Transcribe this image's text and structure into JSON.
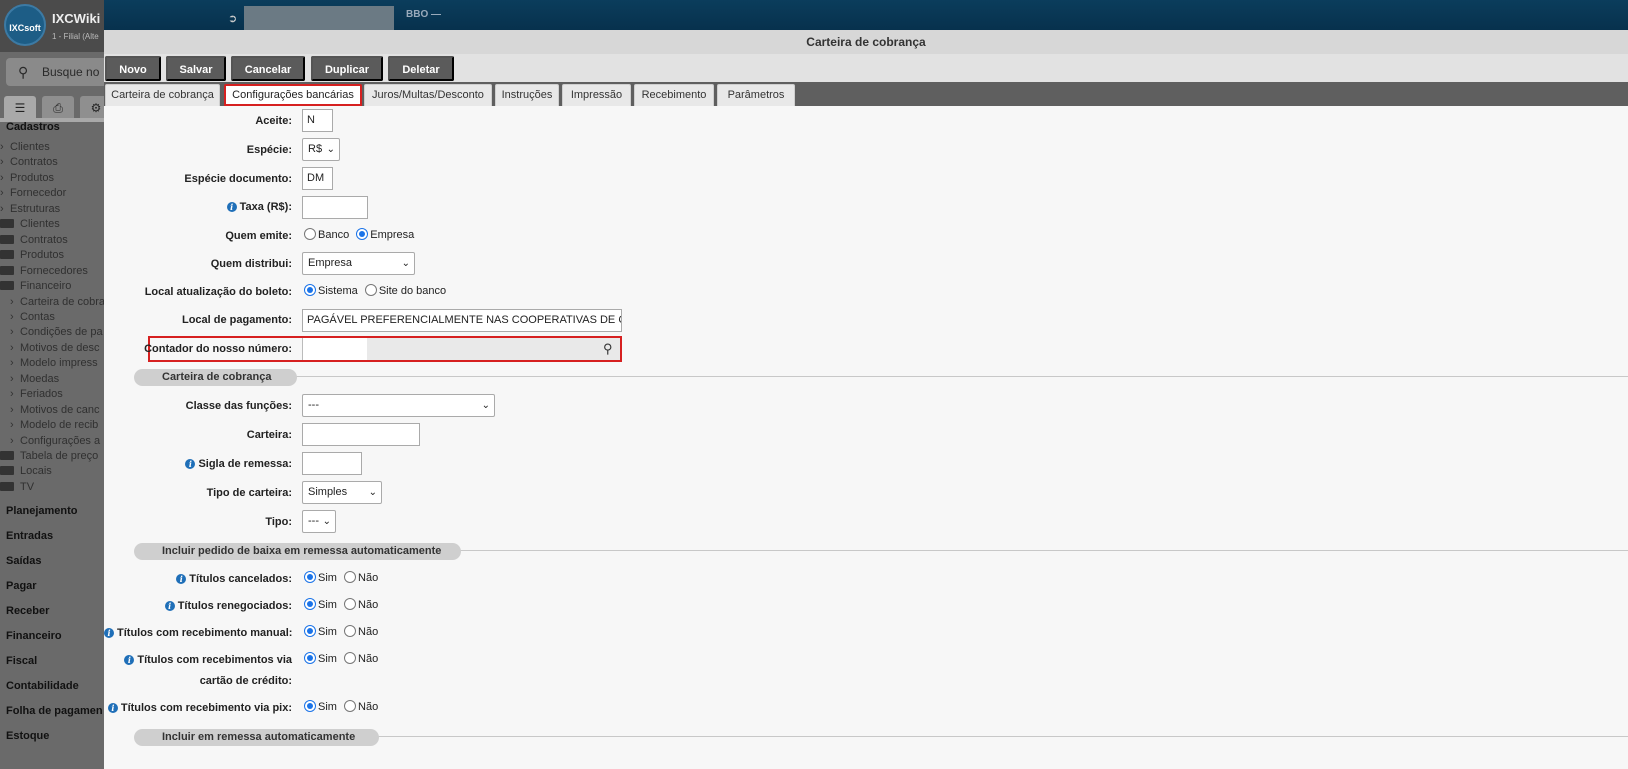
{
  "app": {
    "logo_text": "IXCsoft",
    "title": "IXCWiki",
    "subtitle": "1 - Filial (Alte",
    "search_placeholder": "Busque no",
    "topbar_text": "BBO —"
  },
  "sidebar": {
    "tab_icons": [
      "list-icon",
      "print-icon",
      "gear-icon"
    ],
    "sections_top": "Cadastros",
    "items": [
      {
        "label": "Clientes",
        "kind": "chev"
      },
      {
        "label": "Contratos",
        "kind": "chev"
      },
      {
        "label": "Produtos",
        "kind": "chev"
      },
      {
        "label": "Fornecedor",
        "kind": "chev"
      },
      {
        "label": "Estruturas",
        "kind": "chev"
      },
      {
        "label": "Clientes",
        "kind": "folder"
      },
      {
        "label": "Contratos",
        "kind": "folder"
      },
      {
        "label": "Produtos",
        "kind": "folder"
      },
      {
        "label": "Fornecedores",
        "kind": "folder"
      },
      {
        "label": "Financeiro",
        "kind": "folder-open"
      },
      {
        "label": "Carteira de cobra",
        "kind": "sub"
      },
      {
        "label": "Contas",
        "kind": "sub"
      },
      {
        "label": "Condições de pa",
        "kind": "sub"
      },
      {
        "label": "Motivos de desc",
        "kind": "sub"
      },
      {
        "label": "Modelo impress",
        "kind": "sub"
      },
      {
        "label": "Moedas",
        "kind": "sub"
      },
      {
        "label": "Feriados",
        "kind": "sub"
      },
      {
        "label": "Motivos de canc",
        "kind": "sub"
      },
      {
        "label": "Modelo de recib",
        "kind": "sub"
      },
      {
        "label": "Configurações a",
        "kind": "sub"
      },
      {
        "label": "Tabela de preço",
        "kind": "folder"
      },
      {
        "label": "Locais",
        "kind": "folder"
      },
      {
        "label": "TV",
        "kind": "folder"
      }
    ],
    "sections": [
      "Planejamento",
      "Entradas",
      "Saídas",
      "Pagar",
      "Receber",
      "Financeiro",
      "Fiscal",
      "Contabilidade",
      "Folha de pagamen",
      "Estoque"
    ]
  },
  "modal": {
    "title": "Carteira de cobrança",
    "toolbar": [
      "Novo",
      "Salvar",
      "Cancelar",
      "Duplicar",
      "Deletar"
    ],
    "tabs": [
      "Carteira de cobrança",
      "Configurações bancárias",
      "Juros/Multas/Desconto",
      "Instruções",
      "Impressão",
      "Recebimento",
      "Parâmetros"
    ],
    "active_tab": "Configurações bancárias"
  },
  "form": {
    "aceite": {
      "label": "Aceite:",
      "value": "N"
    },
    "especie": {
      "label": "Espécie:",
      "value": "R$"
    },
    "especie_documento": {
      "label": "Espécie documento:",
      "value": "DM"
    },
    "taxa": {
      "label": "Taxa (R$):",
      "value": ""
    },
    "quem_emite": {
      "label": "Quem emite:",
      "options": [
        "Banco",
        "Empresa"
      ],
      "selected": "Empresa"
    },
    "quem_distribui": {
      "label": "Quem distribui:",
      "value": "Empresa"
    },
    "local_atualizacao": {
      "label": "Local atualização do boleto:",
      "options": [
        "Sistema",
        "Site do banco"
      ],
      "selected": "Sistema"
    },
    "local_pagamento": {
      "label": "Local de pagamento:",
      "value": "PAGÁVEL PREFERENCIALMENTE NAS COOPERATIVAS DE CRE"
    },
    "contador": {
      "label": "Contador do nosso número:",
      "value": ""
    },
    "section_carteira": "Carteira de cobrança",
    "classe_funcoes": {
      "label": "Classe das funções:",
      "value": "---"
    },
    "carteira": {
      "label": "Carteira:",
      "value": ""
    },
    "sigla_remessa": {
      "label": "Sigla de remessa:",
      "value": ""
    },
    "tipo_carteira": {
      "label": "Tipo de carteira:",
      "value": "Simples"
    },
    "tipo": {
      "label": "Tipo:",
      "value": "---"
    },
    "section_baixa": "Incluir pedido de baixa em remessa automaticamente",
    "titulos": [
      {
        "label": "Títulos cancelados:",
        "selected": "Sim"
      },
      {
        "label": "Títulos renegociados:",
        "selected": "Sim"
      },
      {
        "label": "Títulos com recebimento manual:",
        "selected": "Sim"
      },
      {
        "label": "Títulos com recebimentos via",
        "label2": "cartão de crédito:",
        "selected": "Sim"
      },
      {
        "label": "Títulos com recebimento via pix:",
        "selected": "Sim"
      }
    ],
    "yes_label": "Sim",
    "no_label": "Não",
    "section_remessa": "Incluir em remessa automaticamente"
  }
}
